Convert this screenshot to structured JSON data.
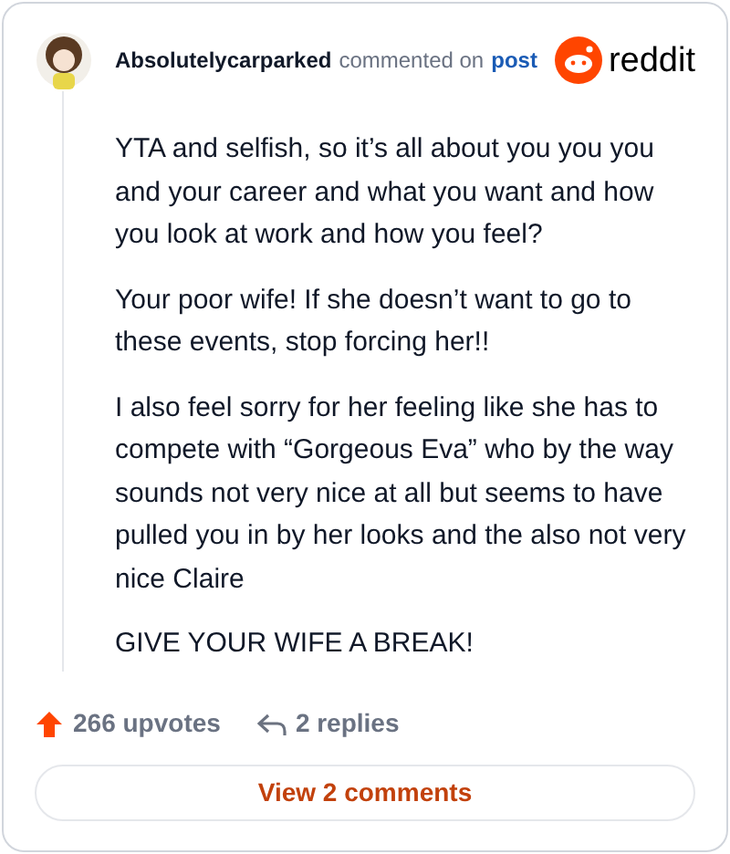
{
  "comment": {
    "author": "Absolutelycarparked",
    "action": "commented on",
    "link": "post",
    "brand": "reddit",
    "paragraphs": [
      "YTA and selfish, so it’s all about you you you and your career and what you want and how you look at work and how you feel?",
      "Your poor wife! If she doesn’t want to go to these events, stop forcing her!!",
      "I also feel sorry for her feeling like she has to compete with “Gorgeous Eva” who by the way sounds not very nice at all but seems to have pulled you in by her looks and the also not very nice Claire",
      "GIVE YOUR WIFE A BREAK!"
    ],
    "upvotes": "266 upvotes",
    "replies": "2 replies",
    "view_button": "View 2 comments"
  }
}
